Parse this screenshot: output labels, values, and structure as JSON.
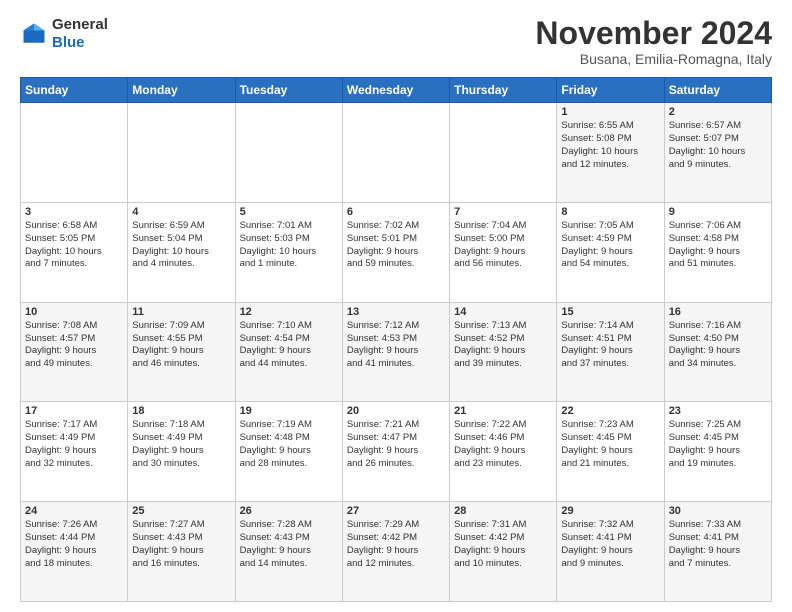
{
  "logo": {
    "general": "General",
    "blue": "Blue"
  },
  "header": {
    "month": "November 2024",
    "location": "Busana, Emilia-Romagna, Italy"
  },
  "days_of_week": [
    "Sunday",
    "Monday",
    "Tuesday",
    "Wednesday",
    "Thursday",
    "Friday",
    "Saturday"
  ],
  "weeks": [
    [
      {
        "day": "",
        "info": ""
      },
      {
        "day": "",
        "info": ""
      },
      {
        "day": "",
        "info": ""
      },
      {
        "day": "",
        "info": ""
      },
      {
        "day": "",
        "info": ""
      },
      {
        "day": "1",
        "info": "Sunrise: 6:55 AM\nSunset: 5:08 PM\nDaylight: 10 hours\nand 12 minutes."
      },
      {
        "day": "2",
        "info": "Sunrise: 6:57 AM\nSunset: 5:07 PM\nDaylight: 10 hours\nand 9 minutes."
      }
    ],
    [
      {
        "day": "3",
        "info": "Sunrise: 6:58 AM\nSunset: 5:05 PM\nDaylight: 10 hours\nand 7 minutes."
      },
      {
        "day": "4",
        "info": "Sunrise: 6:59 AM\nSunset: 5:04 PM\nDaylight: 10 hours\nand 4 minutes."
      },
      {
        "day": "5",
        "info": "Sunrise: 7:01 AM\nSunset: 5:03 PM\nDaylight: 10 hours\nand 1 minute."
      },
      {
        "day": "6",
        "info": "Sunrise: 7:02 AM\nSunset: 5:01 PM\nDaylight: 9 hours\nand 59 minutes."
      },
      {
        "day": "7",
        "info": "Sunrise: 7:04 AM\nSunset: 5:00 PM\nDaylight: 9 hours\nand 56 minutes."
      },
      {
        "day": "8",
        "info": "Sunrise: 7:05 AM\nSunset: 4:59 PM\nDaylight: 9 hours\nand 54 minutes."
      },
      {
        "day": "9",
        "info": "Sunrise: 7:06 AM\nSunset: 4:58 PM\nDaylight: 9 hours\nand 51 minutes."
      }
    ],
    [
      {
        "day": "10",
        "info": "Sunrise: 7:08 AM\nSunset: 4:57 PM\nDaylight: 9 hours\nand 49 minutes."
      },
      {
        "day": "11",
        "info": "Sunrise: 7:09 AM\nSunset: 4:55 PM\nDaylight: 9 hours\nand 46 minutes."
      },
      {
        "day": "12",
        "info": "Sunrise: 7:10 AM\nSunset: 4:54 PM\nDaylight: 9 hours\nand 44 minutes."
      },
      {
        "day": "13",
        "info": "Sunrise: 7:12 AM\nSunset: 4:53 PM\nDaylight: 9 hours\nand 41 minutes."
      },
      {
        "day": "14",
        "info": "Sunrise: 7:13 AM\nSunset: 4:52 PM\nDaylight: 9 hours\nand 39 minutes."
      },
      {
        "day": "15",
        "info": "Sunrise: 7:14 AM\nSunset: 4:51 PM\nDaylight: 9 hours\nand 37 minutes."
      },
      {
        "day": "16",
        "info": "Sunrise: 7:16 AM\nSunset: 4:50 PM\nDaylight: 9 hours\nand 34 minutes."
      }
    ],
    [
      {
        "day": "17",
        "info": "Sunrise: 7:17 AM\nSunset: 4:49 PM\nDaylight: 9 hours\nand 32 minutes."
      },
      {
        "day": "18",
        "info": "Sunrise: 7:18 AM\nSunset: 4:49 PM\nDaylight: 9 hours\nand 30 minutes."
      },
      {
        "day": "19",
        "info": "Sunrise: 7:19 AM\nSunset: 4:48 PM\nDaylight: 9 hours\nand 28 minutes."
      },
      {
        "day": "20",
        "info": "Sunrise: 7:21 AM\nSunset: 4:47 PM\nDaylight: 9 hours\nand 26 minutes."
      },
      {
        "day": "21",
        "info": "Sunrise: 7:22 AM\nSunset: 4:46 PM\nDaylight: 9 hours\nand 23 minutes."
      },
      {
        "day": "22",
        "info": "Sunrise: 7:23 AM\nSunset: 4:45 PM\nDaylight: 9 hours\nand 21 minutes."
      },
      {
        "day": "23",
        "info": "Sunrise: 7:25 AM\nSunset: 4:45 PM\nDaylight: 9 hours\nand 19 minutes."
      }
    ],
    [
      {
        "day": "24",
        "info": "Sunrise: 7:26 AM\nSunset: 4:44 PM\nDaylight: 9 hours\nand 18 minutes."
      },
      {
        "day": "25",
        "info": "Sunrise: 7:27 AM\nSunset: 4:43 PM\nDaylight: 9 hours\nand 16 minutes."
      },
      {
        "day": "26",
        "info": "Sunrise: 7:28 AM\nSunset: 4:43 PM\nDaylight: 9 hours\nand 14 minutes."
      },
      {
        "day": "27",
        "info": "Sunrise: 7:29 AM\nSunset: 4:42 PM\nDaylight: 9 hours\nand 12 minutes."
      },
      {
        "day": "28",
        "info": "Sunrise: 7:31 AM\nSunset: 4:42 PM\nDaylight: 9 hours\nand 10 minutes."
      },
      {
        "day": "29",
        "info": "Sunrise: 7:32 AM\nSunset: 4:41 PM\nDaylight: 9 hours\nand 9 minutes."
      },
      {
        "day": "30",
        "info": "Sunrise: 7:33 AM\nSunset: 4:41 PM\nDaylight: 9 hours\nand 7 minutes."
      }
    ]
  ]
}
